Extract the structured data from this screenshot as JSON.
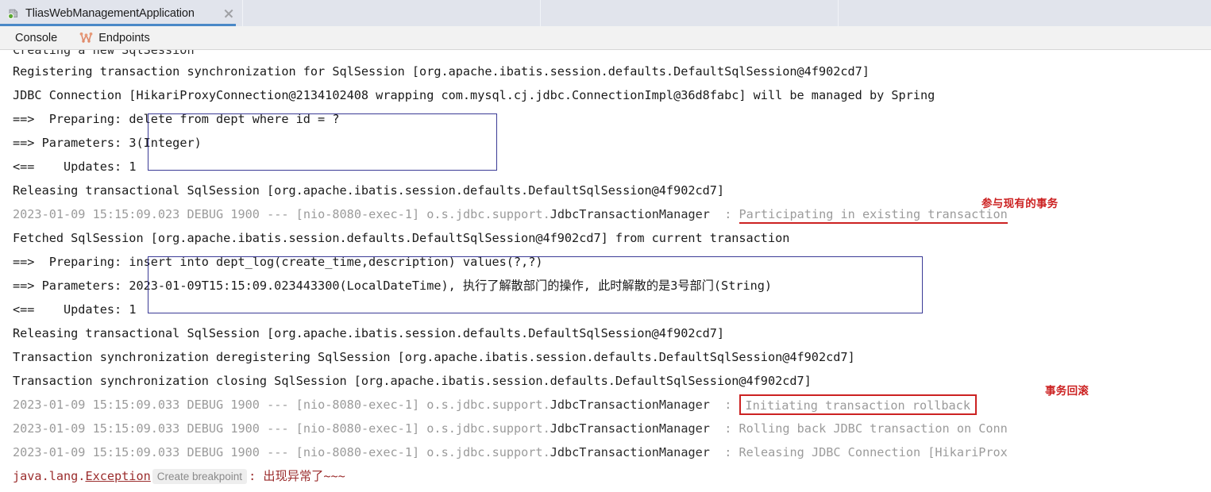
{
  "window": {
    "tab": {
      "title": "TliasWebManagementApplication",
      "icon": "spring-run-config-icon",
      "close_icon": "close-icon"
    }
  },
  "toolbar": {
    "console_label": "Console",
    "endpoints_label": "Endpoints",
    "endpoints_icon": "endpoints-graph-icon"
  },
  "colors": {
    "accent_tab_underline": "#4a88c7",
    "annotation_red": "#cc2222",
    "sql_box_blue": "#3b3b96",
    "exception_red": "#9b2d2d",
    "log_gray": "#9b9b9b",
    "tabstrip_bg": "#e1e4ec",
    "toolbar_bg": "#f2f2f2"
  },
  "console": {
    "lines": [
      {
        "id": "l0",
        "kind": "clipped",
        "text": "Creating a new SqlSession"
      },
      {
        "id": "l1",
        "kind": "plain",
        "text": "Registering transaction synchronization for SqlSession [org.apache.ibatis.session.defaults.DefaultSqlSession@4f902cd7]"
      },
      {
        "id": "l2",
        "kind": "plain",
        "text": "JDBC Connection [HikariProxyConnection@2134102408 wrapping com.mysql.cj.jdbc.ConnectionImpl@36d8fabc] will be managed by Spring"
      },
      {
        "id": "l3",
        "kind": "sql",
        "label": "==>  Preparing: ",
        "value": "delete from dept where id = ?"
      },
      {
        "id": "l4",
        "kind": "sql",
        "label": "==> Parameters: ",
        "value": "3(Integer)"
      },
      {
        "id": "l5",
        "kind": "sql",
        "label": "<==    Updates: ",
        "value": "1"
      },
      {
        "id": "l6",
        "kind": "plain",
        "text": "Releasing transactional SqlSession [org.apache.ibatis.session.defaults.DefaultSqlSession@4f902cd7]"
      },
      {
        "id": "l7",
        "kind": "log",
        "timestamp": "2023-01-09 15:15:09.023",
        "level": "DEBUG",
        "pid": "1900",
        "sep": "---",
        "thread": "[nio-8080-exec-1]",
        "logger_pkg": "o.s.jdbc.support.",
        "logger_cls": "JdbcTransactionManager",
        "colon": ":",
        "message": "Participating in existing transaction",
        "message_style": "underline"
      },
      {
        "id": "l8",
        "kind": "plain",
        "text": "Fetched SqlSession [org.apache.ibatis.session.defaults.DefaultSqlSession@4f902cd7] from current transaction"
      },
      {
        "id": "l9",
        "kind": "sql",
        "label": "==>  Preparing: ",
        "value": "insert into dept_log(create_time,description) values(?,?)"
      },
      {
        "id": "l10",
        "kind": "sql",
        "label": "==> Parameters: ",
        "value": "2023-01-09T15:15:09.023443300(LocalDateTime), 执行了解散部门的操作, 此时解散的是3号部门(String)"
      },
      {
        "id": "l11",
        "kind": "sql",
        "label": "<==    Updates: ",
        "value": "1"
      },
      {
        "id": "l12",
        "kind": "plain",
        "text": "Releasing transactional SqlSession [org.apache.ibatis.session.defaults.DefaultSqlSession@4f902cd7]"
      },
      {
        "id": "l13",
        "kind": "plain",
        "text": "Transaction synchronization deregistering SqlSession [org.apache.ibatis.session.defaults.DefaultSqlSession@4f902cd7]"
      },
      {
        "id": "l14",
        "kind": "plain",
        "text": "Transaction synchronization closing SqlSession [org.apache.ibatis.session.defaults.DefaultSqlSession@4f902cd7]"
      },
      {
        "id": "l15",
        "kind": "log",
        "timestamp": "2023-01-09 15:15:09.033",
        "level": "DEBUG",
        "pid": "1900",
        "sep": "---",
        "thread": "[nio-8080-exec-1]",
        "logger_pkg": "o.s.jdbc.support.",
        "logger_cls": "JdbcTransactionManager",
        "colon": ":",
        "message": "Initiating transaction rollback",
        "message_style": "box"
      },
      {
        "id": "l16",
        "kind": "log",
        "timestamp": "2023-01-09 15:15:09.033",
        "level": "DEBUG",
        "pid": "1900",
        "sep": "---",
        "thread": "[nio-8080-exec-1]",
        "logger_pkg": "o.s.jdbc.support.",
        "logger_cls": "JdbcTransactionManager",
        "colon": ":",
        "message": "Rolling back JDBC transaction on Conn",
        "message_style": "plain"
      },
      {
        "id": "l17",
        "kind": "log",
        "timestamp": "2023-01-09 15:15:09.033",
        "level": "DEBUG",
        "pid": "1900",
        "sep": "---",
        "thread": "[nio-8080-exec-1]",
        "logger_pkg": "o.s.jdbc.support.",
        "logger_cls": "JdbcTransactionManager",
        "colon": ":",
        "message": "Releasing JDBC Connection [HikariProx",
        "message_style": "plain"
      },
      {
        "id": "l18",
        "kind": "exception",
        "class_prefix": "java.lang.",
        "class_name": "Exception",
        "breakpoint_chip": "Create breakpoint",
        "colon": ":",
        "message": "出现异常了~~~"
      }
    ]
  },
  "annotations": [
    {
      "id": "a1",
      "text": "参与现有的事务"
    },
    {
      "id": "a2",
      "text": "事务回滚"
    }
  ]
}
